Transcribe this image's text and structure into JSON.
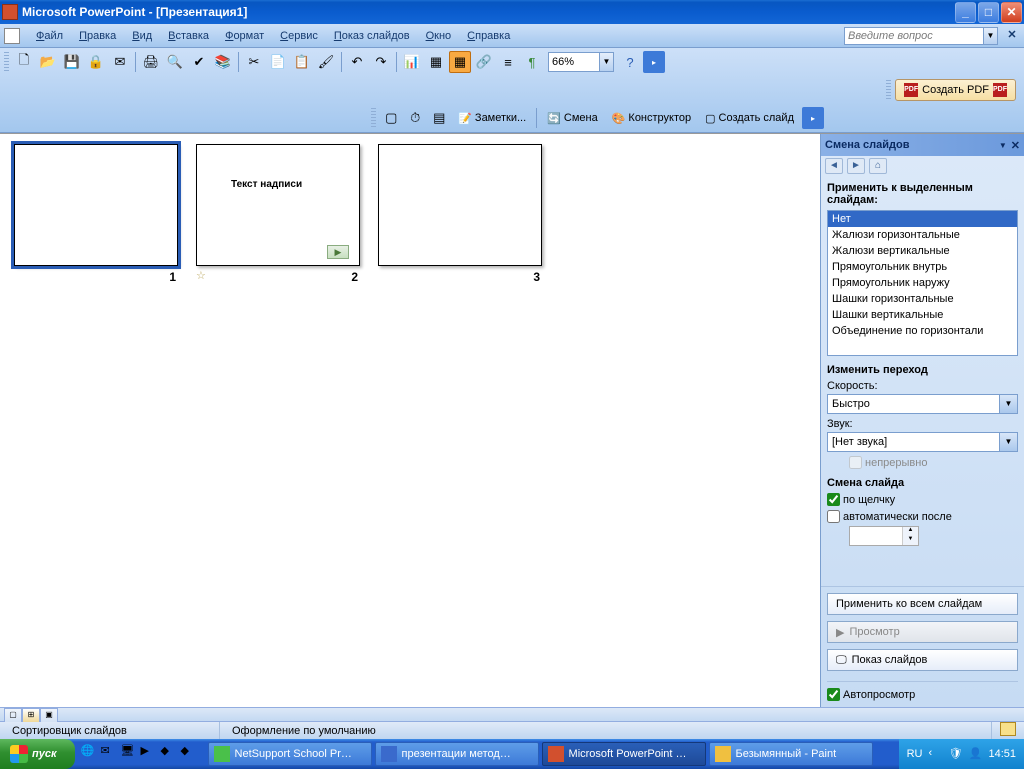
{
  "titlebar": {
    "title": "Microsoft PowerPoint - [Презентация1]"
  },
  "menu": {
    "file": "Файл",
    "edit": "Правка",
    "view": "Вид",
    "insert": "Вставка",
    "format": "Формат",
    "service": "Сервис",
    "slideshow": "Показ слайдов",
    "window": "Окно",
    "help": "Справка",
    "help_placeholder": "Введите вопрос"
  },
  "toolbar": {
    "zoom": "66%",
    "pdf_button": "Создать PDF"
  },
  "toolbar3": {
    "notes": "Заметки...",
    "transition": "Смена",
    "designer": "Конструктор",
    "new_slide": "Создать слайд"
  },
  "slides": {
    "s1_num": "1",
    "s2_num": "2",
    "s3_num": "3",
    "s2_caption_text": "Текст надписи"
  },
  "taskpane": {
    "title": "Смена слайдов",
    "apply_to_label": "Применить к выделенным слайдам:",
    "transitions": [
      "Нет",
      "Жалюзи горизонтальные",
      "Жалюзи вертикальные",
      "Прямоугольник внутрь",
      "Прямоугольник наружу",
      "Шашки горизонтальные",
      "Шашки вертикальные",
      "Объединение по горизонтали"
    ],
    "modify_header": "Изменить переход",
    "speed_label": "Скорость:",
    "speed_value": "Быстро",
    "sound_label": "Звук:",
    "sound_value": "[Нет звука]",
    "loop_label": "непрерывно",
    "advance_header": "Смена слайда",
    "on_click_label": "по щелчку",
    "auto_after_label": "автоматически после",
    "apply_all": "Применить ко всем слайдам",
    "preview": "Просмотр",
    "slideshow": "Показ слайдов",
    "autopreview": "Автопросмотр"
  },
  "statusbar": {
    "mode": "Сортировщик слайдов",
    "template": "Оформление по умолчанию"
  },
  "taskbar": {
    "start": "пуск",
    "t1": "NetSupport School Pr…",
    "t2": "презентации метод…",
    "t3": "Microsoft PowerPoint …",
    "t4": "Безымянный - Paint",
    "lang": "RU",
    "time": "14:51"
  }
}
